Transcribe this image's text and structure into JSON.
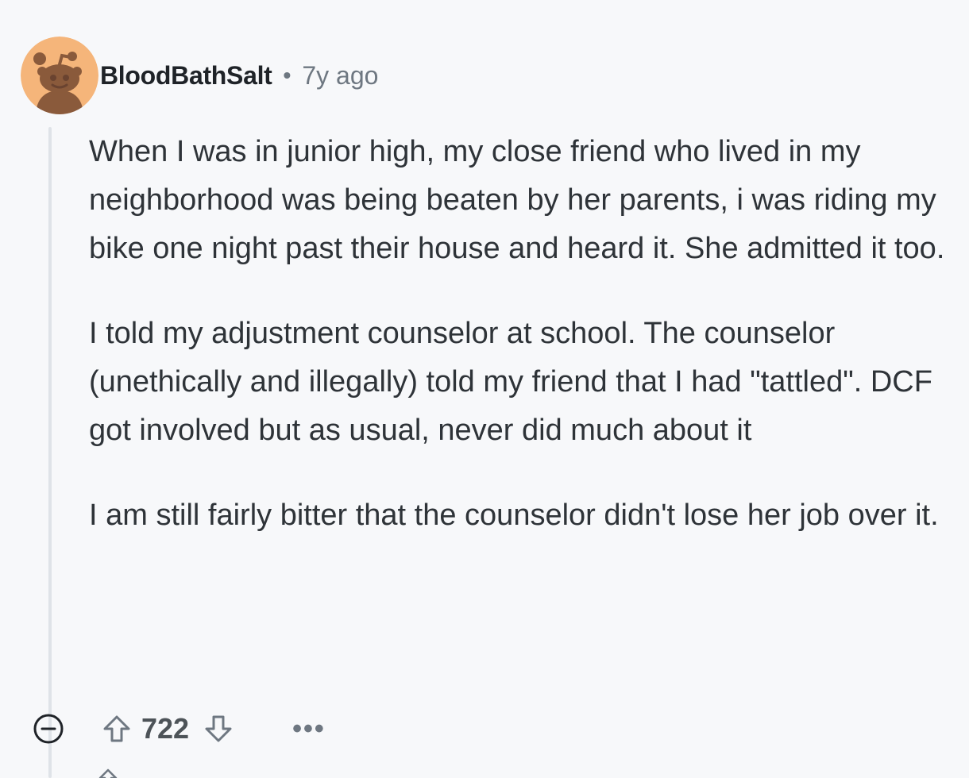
{
  "comment": {
    "author": {
      "username": "BloodBathSalt",
      "avatar_icon": "reddit-snoo-avatar-icon",
      "avatar_bg": "#f5b57a"
    },
    "separator": "•",
    "timestamp": "7y ago",
    "paragraphs": [
      "When I was in junior high, my close friend who lived in my neighborhood was being beaten by her parents, i was riding my bike one night past their house and heard it. She admitted it too.",
      "I told my adjustment counselor at school. The counselor (unethically and illegally) told my friend that I had \"tattled\". DCF got involved but as usual, never did much about it",
      "I am still fairly bitter that the counselor didn't lose her job over it."
    ],
    "actions": {
      "collapse_icon": "collapse-minus-icon",
      "upvote_icon": "upvote-arrow-icon",
      "vote_count": "722",
      "downvote_icon": "downvote-arrow-icon",
      "more_label": "•••"
    }
  },
  "colors": {
    "background": "#f7f8fa",
    "text": "#2e3338",
    "muted": "#6e7781",
    "thread_line": "#dfe3e8"
  }
}
